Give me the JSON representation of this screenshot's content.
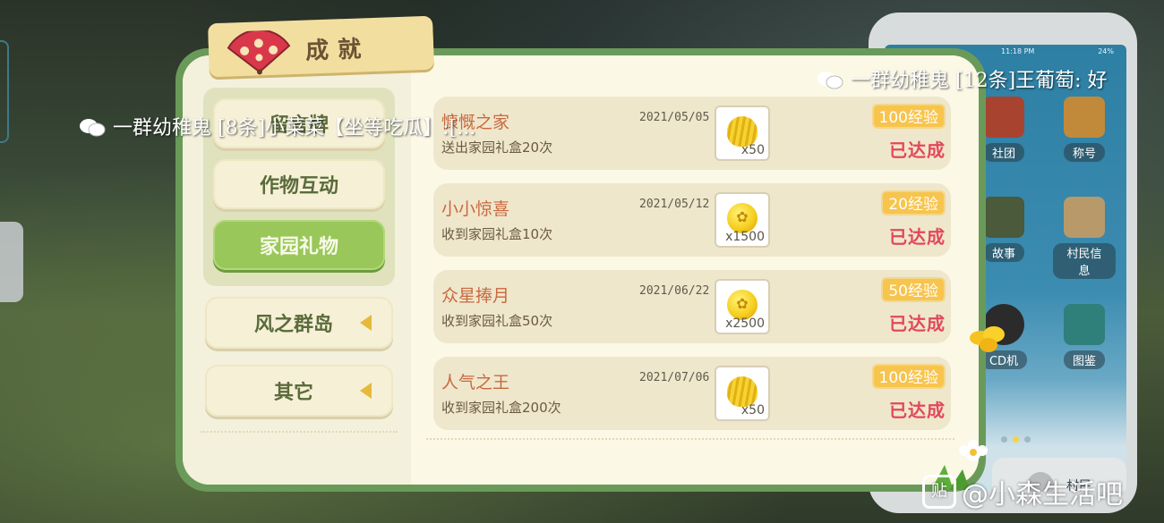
{
  "header": {
    "title": "成就"
  },
  "categories": {
    "group_items": [
      {
        "label": "留言牌",
        "active": false
      },
      {
        "label": "作物互动",
        "active": false
      },
      {
        "label": "家园礼物",
        "active": true
      }
    ],
    "others": [
      {
        "label": "风之群岛"
      },
      {
        "label": "其它"
      }
    ]
  },
  "achievements": [
    {
      "title": "慷慨之家",
      "desc": "送出家园礼盒20次",
      "date": "2021/05/05",
      "reward_qty": "x50",
      "reward_icon": "shell-coin-icon",
      "xp": "100经验",
      "status": "已达成"
    },
    {
      "title": "小小惊喜",
      "desc": "收到家园礼盒10次",
      "date": "2021/05/12",
      "reward_qty": "x1500",
      "reward_icon": "gold-coin-icon",
      "xp": "20经验",
      "status": "已达成"
    },
    {
      "title": "众星捧月",
      "desc": "收到家园礼盒50次",
      "date": "2021/06/22",
      "reward_qty": "x2500",
      "reward_icon": "gold-coin-icon",
      "xp": "50经验",
      "status": "已达成"
    },
    {
      "title": "人气之王",
      "desc": "收到家园礼盒200次",
      "date": "2021/07/06",
      "reward_qty": "x50",
      "reward_icon": "shell-coin-icon",
      "xp": "100经验",
      "status": "已达成"
    }
  ],
  "phone": {
    "status_time": "11:18 PM",
    "status_battery": "24%",
    "apps": [
      {
        "label": "社团"
      },
      {
        "label": "称号"
      },
      {
        "label": "故事"
      },
      {
        "label": "村民信息"
      },
      {
        "label": "CD机"
      },
      {
        "label": "图鉴"
      }
    ],
    "dock_label": "村民"
  },
  "danmaku": [
    {
      "text": "一群幼稚鬼 [12条]王葡萄: 好"
    },
    {
      "text": "一群幼稚鬼 [8条]小菜菜【坐等吃瓜】:[..."
    }
  ],
  "watermark": {
    "badge": "贴",
    "text": "@小森生活吧"
  },
  "colors": {
    "panel_border": "#6a9a59",
    "active_tab": "#99c75a",
    "title_red": "#c9683f",
    "status_red": "#e2485b",
    "xp_badge": "#f7c44d"
  }
}
